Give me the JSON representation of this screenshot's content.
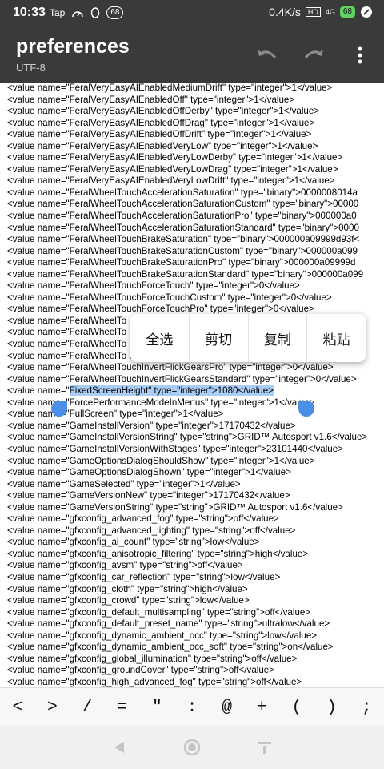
{
  "status_bar": {
    "time": "10:33",
    "app_label": "Tap",
    "notif_count": "68",
    "net_speed": "0.4K/s",
    "hd": "HD",
    "signal": "4G",
    "battery": "68"
  },
  "toolbar": {
    "title": "preferences",
    "subtitle": "UTF-8"
  },
  "lines": [
    "<value  name=\"FeralVeryEasyAIEnabledMediumDrift\"  type=\"integer\">1</value>",
    "<value  name=\"FeralVeryEasyAIEnabledOff\"  type=\"integer\">1</value>",
    "<value  name=\"FeralVeryEasyAIEnabledOffDerby\"  type=\"integer\">1</value>",
    "<value  name=\"FeralVeryEasyAIEnabledOffDrag\"  type=\"integer\">1</value>",
    "<value  name=\"FeralVeryEasyAIEnabledOffDrift\"  type=\"integer\">1</value>",
    "<value  name=\"FeralVeryEasyAIEnabledVeryLow\"  type=\"integer\">1</value>",
    "<value  name=\"FeralVeryEasyAIEnabledVeryLowDerby\"  type=\"integer\">1</value>",
    "<value  name=\"FeralVeryEasyAIEnabledVeryLowDrag\"  type=\"integer\">1</value>",
    "<value  name=\"FeralVeryEasyAIEnabledVeryLowDrift\"  type=\"integer\">1</value>",
    "<value  name=\"FeralWheelTouchAccelerationSaturation\"  type=\"binary\">0000008014a",
    "<value  name=\"FeralWheelTouchAccelerationSaturationCustom\"  type=\"binary\">00000",
    "<value  name=\"FeralWheelTouchAccelerationSaturationPro\"  type=\"binary\">000000a0",
    "<value  name=\"FeralWheelTouchAccelerationSaturationStandard\"  type=\"binary\">0000",
    "<value  name=\"FeralWheelTouchBrakeSaturation\"  type=\"binary\">000000a09999d93f<",
    "<value  name=\"FeralWheelTouchBrakeSaturationCustom\"  type=\"binary\">000000a099",
    "<value  name=\"FeralWheelTouchBrakeSaturationPro\"  type=\"binary\">000000a09999d",
    "<value  name=\"FeralWheelTouchBrakeSaturationStandard\"  type=\"binary\">000000a099",
    "<value  name=\"FeralWheelTouchForceTouch\"  type=\"integer\">0</value>",
    "<value  name=\"FeralWheelTouchForceTouchCustom\"  type=\"integer\">0</value>",
    "<value  name=\"FeralWheelTouchForceTouchPro\"  type=\"integer\">0</value>",
    "<value  name=\"FeralWheelTo",
    "<value  name=\"FeralWheelTo",
    "<value  name=\"FeralWheelTo",
    "<value  name=\"FeralWheelTo                                                                                  e>",
    "<value  name=\"FeralWheelTouchInvertFlickGearsPro\"  type=\"integer\">0</value>",
    "<value  name=\"FeralWheelTouchInvertFlickGearsStandard\"  type=\"integer\">0</value>",
    "<value  name=\"FixedScreenHeight\"  type=\"integer\">1080</value>",
    "<value  name=\"ForcePerformanceModeInMenus\"  type=\"integer\">1</value>",
    "<value  name=\"FullScreen\"  type=\"integer\">1</value>",
    "<value  name=\"GameInstallVersion\"  type=\"integer\">17170432</value>",
    "<value  name=\"GameInstallVersionString\"  type=\"string\">GRID™  Autosport  v1.6</value>",
    "<value  name=\"GameInstallVersionWithStages\"  type=\"integer\">23101440</value>",
    "<value  name=\"GameOptionsDialogShouldShow\"  type=\"integer\">1</value>",
    "<value  name=\"GameOptionsDialogShown\"  type=\"integer\">1</value>",
    "<value  name=\"GameSelected\"  type=\"integer\">1</value>",
    "<value  name=\"GameVersionNew\"  type=\"integer\">17170432</value>",
    "<value  name=\"GameVersionString\"  type=\"string\">GRID™  Autosport  v1.6</value>",
    "<value  name=\"gfxconfig_advanced_fog\"  type=\"string\">off</value>",
    "<value  name=\"gfxconfig_advanced_lighting\"  type=\"string\">off</value>",
    "<value  name=\"gfxconfig_ai_count\"  type=\"string\">low</value>",
    "<value  name=\"gfxconfig_anisotropic_filtering\"  type=\"string\">high</value>",
    "<value  name=\"gfxconfig_avsm\"  type=\"string\">off</value>",
    "<value  name=\"gfxconfig_car_reflection\"  type=\"string\">low</value>",
    "<value  name=\"gfxconfig_cloth\"  type=\"string\">high</value>",
    "<value  name=\"gfxconfig_crowd\"  type=\"string\">low</value>",
    "<value  name=\"gfxconfig_default_multisampling\"  type=\"string\">off</value>",
    "<value  name=\"gfxconfig_default_preset_name\"  type=\"string\">ultralow</value>",
    "<value  name=\"gfxconfig_dynamic_ambient_occ\"  type=\"string\">low</value>",
    "<value  name=\"gfxconfig_dynamic_ambient_occ_soft\"  type=\"string\">on</value>",
    "<value  name=\"gfxconfig_global_illumination\"  type=\"string\">off</value>",
    "<value  name=\"gfxconfig_groundCover\"  type=\"string\">off</value>",
    "<value  name=\"gfxconfig_high_advanced_fog\"  type=\"string\">off</value>"
  ],
  "selected_text": "FixedScreenHeight\"  type=\"integer\">1080</value>",
  "context_menu": [
    "全选",
    "剪切",
    "复制",
    "粘贴"
  ],
  "symbols": [
    "<",
    ">",
    "/",
    "=",
    "\"",
    ":",
    "@",
    "+",
    "(",
    ")",
    ";"
  ]
}
